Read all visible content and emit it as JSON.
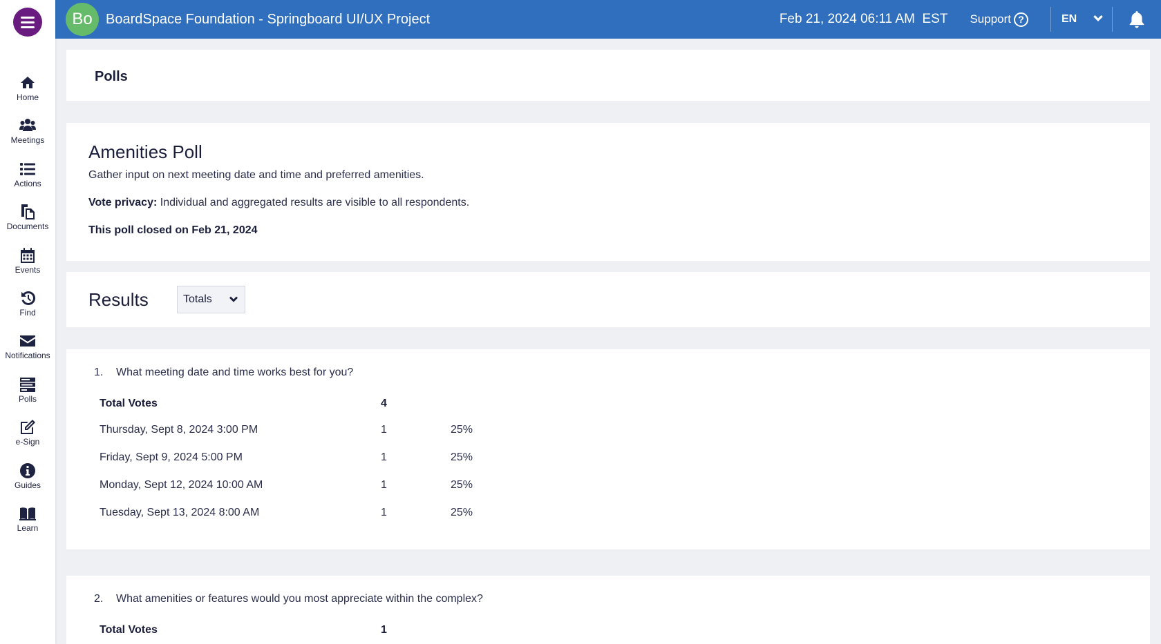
{
  "header": {
    "avatar_initials": "Bo",
    "org_title": "BoardSpace Foundation - Springboard UI/UX Project",
    "datetime": "Feb 21, 2024 06:11 AM",
    "timezone": "EST",
    "support_label": "Support",
    "support_icon": "?",
    "language": "EN"
  },
  "sidebar": {
    "items": [
      {
        "label": "Home",
        "icon": "home-icon"
      },
      {
        "label": "Meetings",
        "icon": "people-icon"
      },
      {
        "label": "Actions",
        "icon": "list-icon"
      },
      {
        "label": "Documents",
        "icon": "documents-icon"
      },
      {
        "label": "Events",
        "icon": "calendar-icon"
      },
      {
        "label": "Find",
        "icon": "history-icon"
      },
      {
        "label": "Notifications",
        "icon": "envelope-icon"
      },
      {
        "label": "Polls",
        "icon": "poll-icon"
      },
      {
        "label": "e-Sign",
        "icon": "edit-icon"
      },
      {
        "label": "Guides",
        "icon": "info-icon"
      },
      {
        "label": "Learn",
        "icon": "book-icon"
      }
    ]
  },
  "page": {
    "title": "Polls"
  },
  "poll": {
    "title": "Amenities Poll",
    "description": "Gather input on next meeting date and time and preferred amenities.",
    "privacy_label": "Vote privacy:",
    "privacy_text": " Individual and aggregated results are visible to all respondents.",
    "closed_text": "This poll closed on Feb 21, 2024"
  },
  "results": {
    "title": "Results",
    "view_selected": "Totals"
  },
  "questions": [
    {
      "number": "1.",
      "text": "What meeting date and time works best for you?",
      "total_label": "Total Votes",
      "total_votes": "4",
      "options": [
        {
          "label": "Thursday, Sept 8, 2024 3:00 PM",
          "votes": "1",
          "percent": "25%"
        },
        {
          "label": "Friday, Sept 9, 2024 5:00 PM",
          "votes": "1",
          "percent": "25%"
        },
        {
          "label": "Monday, Sept 12, 2024 10:00 AM",
          "votes": "1",
          "percent": "25%"
        },
        {
          "label": "Tuesday, Sept 13, 2024 8:00 AM",
          "votes": "1",
          "percent": "25%"
        }
      ]
    },
    {
      "number": "2.",
      "text": "What amenities or features would you most appreciate within the complex?",
      "total_label": "Total Votes",
      "total_votes": "1"
    }
  ],
  "colors": {
    "topbar": "#2f6fbd",
    "menu_button": "#6a1b7f",
    "avatar": "#66bb6a"
  }
}
